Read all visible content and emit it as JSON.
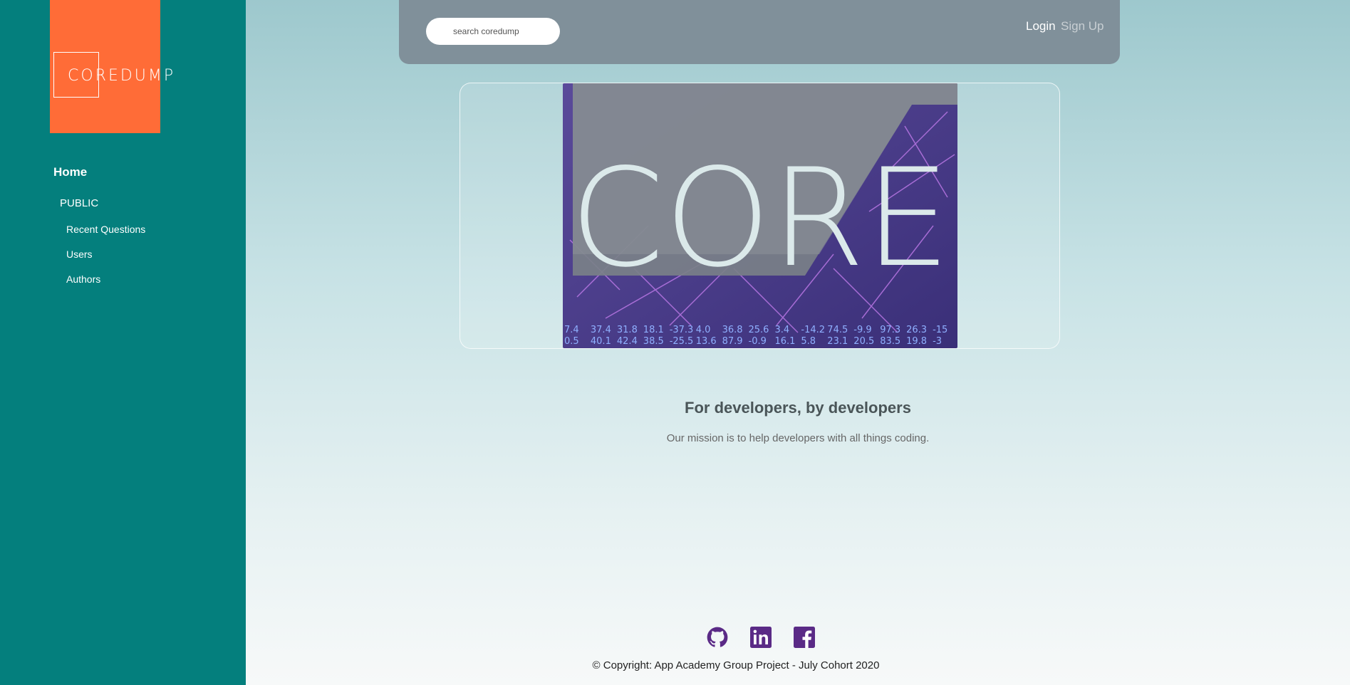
{
  "brand": {
    "logo_text": "COREDUMP",
    "accent": "#ff6c37",
    "sidebar_color": "#047f7d"
  },
  "sidebar": {
    "home_label": "Home",
    "section_label": "PUBLIC",
    "items": [
      {
        "label": "Recent Questions"
      },
      {
        "label": "Users"
      },
      {
        "label": "Authors"
      }
    ]
  },
  "header": {
    "search_placeholder": "search coredump",
    "login_label": "Login",
    "signup_label": "Sign Up"
  },
  "hero": {
    "image_text": "CORE",
    "numbers_row1": [
      "7.4",
      "37.4",
      "31.8",
      "18.1",
      "-37.3",
      "4.0",
      "36.8",
      "25.6",
      "3.4",
      "-14.2",
      "74.5",
      "-9.9",
      "97.3",
      "26.3",
      "-15"
    ],
    "numbers_row2": [
      "0.5",
      "40.1",
      "42.4",
      "38.5",
      "-25.5",
      "13.6",
      "87.9",
      "-0.9",
      "16.1",
      "5.8",
      "23.1",
      "20.5",
      "83.5",
      "19.8",
      "-3"
    ]
  },
  "main": {
    "headline": "For developers, by developers",
    "tagline": "Our mission is to help developers with all things coding."
  },
  "footer": {
    "icons": [
      "github-icon",
      "linkedin-icon",
      "facebook-icon"
    ],
    "icon_color": "#5a2a86",
    "copyright": "© Copyright: App Academy Group Project - July Cohort 2020"
  }
}
